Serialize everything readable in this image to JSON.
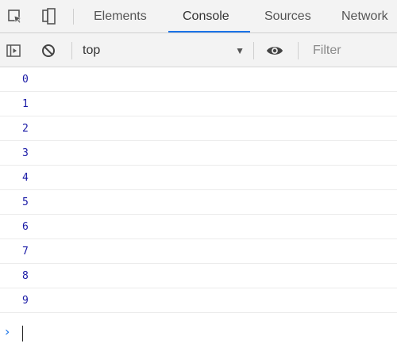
{
  "tabs": [
    {
      "label": "Elements",
      "active": false
    },
    {
      "label": "Console",
      "active": true
    },
    {
      "label": "Sources",
      "active": false
    },
    {
      "label": "Network",
      "active": false
    }
  ],
  "toolbar_icons": {
    "inspect": "inspect-element-icon",
    "device": "device-toolbar-icon"
  },
  "console_toolbar": {
    "sidebar_icon": "show-sidebar-icon",
    "clear_icon": "clear-console-icon",
    "context": "top",
    "context_arrow": "▼",
    "eye_icon": "live-expression-icon",
    "filter_placeholder": "Filter",
    "filter_value": ""
  },
  "log_entries": [
    "0",
    "1",
    "2",
    "3",
    "4",
    "5",
    "6",
    "7",
    "8",
    "9"
  ],
  "prompt": {
    "chevron": "›"
  },
  "colors": {
    "accent": "#1a73e8",
    "number": "#1a1aa6",
    "toolbar_bg": "#f3f3f3"
  }
}
